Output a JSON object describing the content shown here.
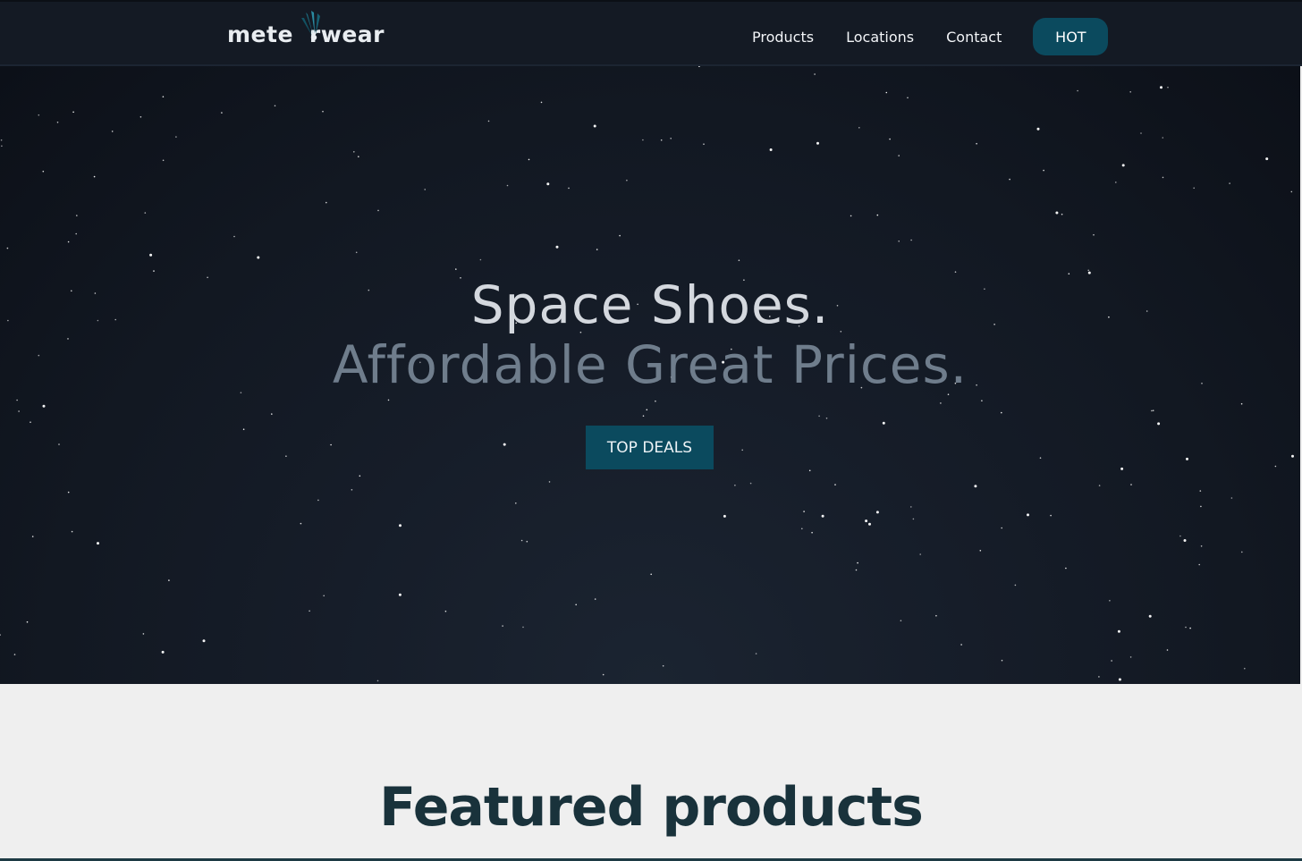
{
  "nav": {
    "brand_left": "mete",
    "brand_right": "rwear",
    "links": [
      "Products",
      "Locations",
      "Contact"
    ],
    "hot_label": "HOT"
  },
  "hero": {
    "line1": "Space Shoes.",
    "line2": "Affordable Great Prices.",
    "cta_label": "TOP DEALS"
  },
  "featured": {
    "title": "Featured products"
  },
  "colors": {
    "nav_bg": "#141a24",
    "accent": "#0b4a5e",
    "hero_bg": "#121822",
    "section_bg": "#efefef",
    "title_text": "#19323b"
  },
  "icons": {
    "logo_mark": "comet-icon"
  }
}
